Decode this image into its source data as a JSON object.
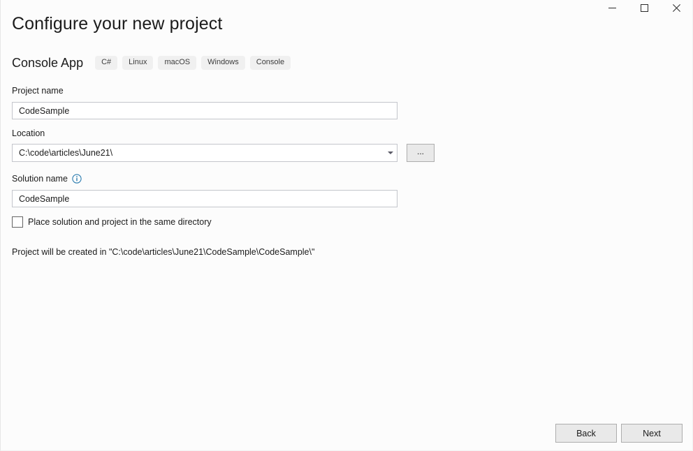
{
  "window": {
    "caption_buttons": [
      {
        "name": "minimize",
        "glyph": "minimize-icon",
        "title": "Minimize"
      },
      {
        "name": "maximize",
        "glyph": "maximize-icon",
        "title": "Maximize"
      },
      {
        "name": "close",
        "glyph": "close-icon",
        "title": "Close"
      }
    ]
  },
  "page": {
    "title": "Configure your new project"
  },
  "template": {
    "name": "Console App",
    "tags": [
      "C#",
      "Linux",
      "macOS",
      "Windows",
      "Console"
    ]
  },
  "form": {
    "project_name": {
      "label": "Project name",
      "value": "CodeSample",
      "placeholder": ""
    },
    "location": {
      "label": "Location",
      "value": "C:\\code\\articles\\June21\\",
      "placeholder": "",
      "browse_label": "...",
      "dropdown_icon": "chevron-down-icon"
    },
    "solution_name": {
      "label": "Solution name",
      "value": "CodeSample",
      "placeholder": "",
      "info_icon": "info-icon"
    },
    "same_directory": {
      "label": "Place solution and project in the same directory",
      "checked": false
    }
  },
  "status": {
    "text": "Project will be created in \"C:\\code\\articles\\June21\\CodeSample\\CodeSample\\\""
  },
  "footer": {
    "back_label": "Back",
    "next_label": "Next"
  },
  "colors": {
    "background": "#fcfcfc",
    "input_border": "#c4c6cc",
    "tag_background": "#f0f0f0",
    "button_face": "#e9e9e9",
    "button_border": "#adadad",
    "info_accent": "#2b7cb0",
    "text": "#1b1b1b"
  }
}
